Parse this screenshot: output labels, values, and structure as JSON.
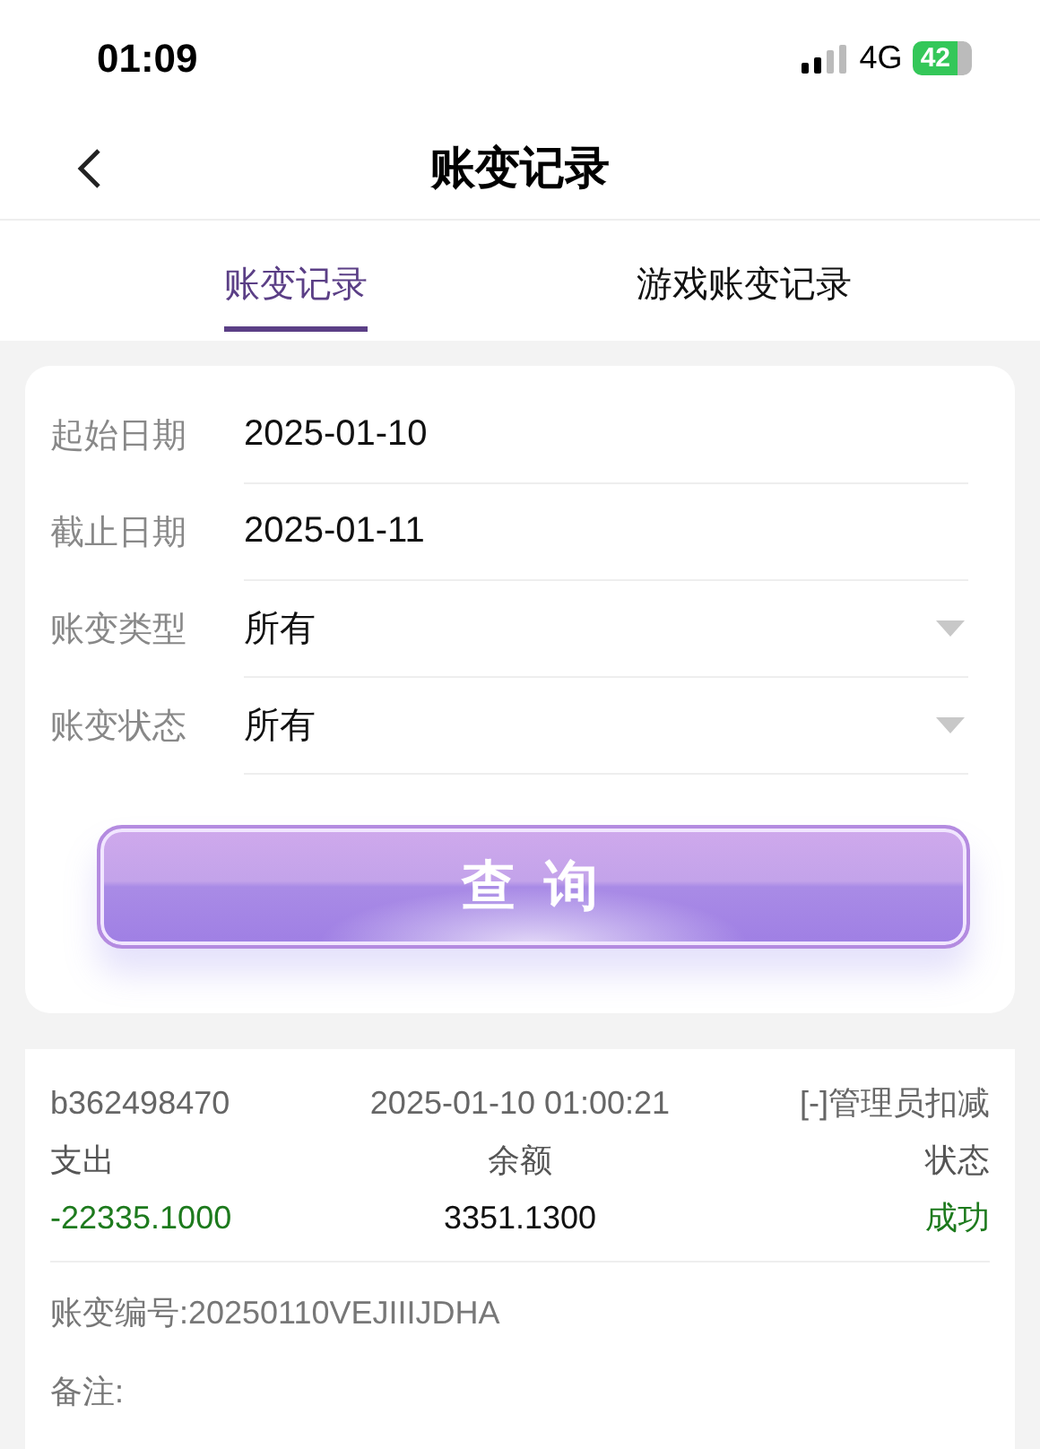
{
  "status_bar": {
    "time": "01:09",
    "network": "4G",
    "battery": "42"
  },
  "header": {
    "title": "账变记录"
  },
  "tabs": [
    {
      "label": "账变记录",
      "selected": true
    },
    {
      "label": "游戏账变记录",
      "selected": false
    }
  ],
  "filters": [
    {
      "kind": "date",
      "label": "起始日期",
      "value": "2025-01-10"
    },
    {
      "kind": "date",
      "label": "截止日期",
      "value": "2025-01-11"
    },
    {
      "kind": "select",
      "label": "账变类型",
      "value": "所有"
    },
    {
      "kind": "select",
      "label": "账变状态",
      "value": "所有"
    }
  ],
  "query_button": "查 询",
  "records": [
    {
      "user": "b362498470",
      "time": "2025-01-10 01:00:21",
      "type": "[-]管理员扣减",
      "amount_label": "支出",
      "balance_label": "余额",
      "status_label": "状态",
      "amount": "-22335.1000",
      "balance": "3351.1300",
      "status": "成功",
      "serial": "账变编号:20250110VEJIIIJDHA",
      "remark": "备注:"
    }
  ]
}
